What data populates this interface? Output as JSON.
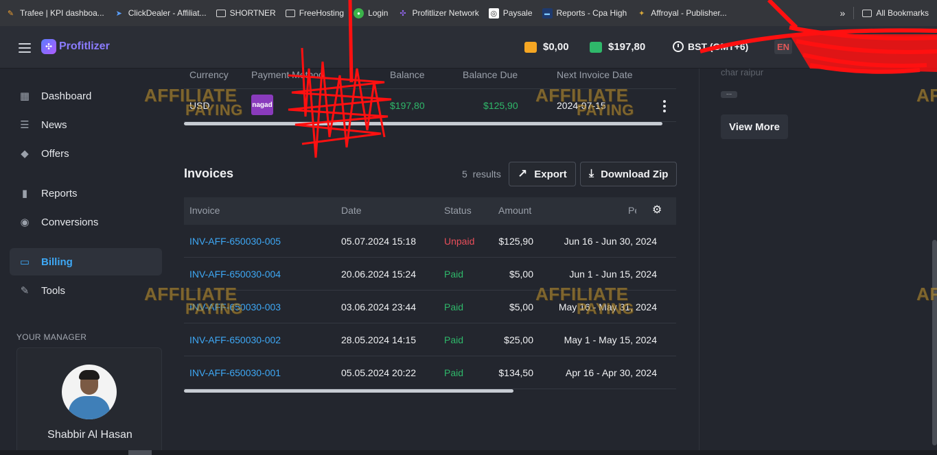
{
  "bookmarks": [
    {
      "label": "Trafee | KPI dashboa...",
      "icon": "trafee-icon"
    },
    {
      "label": "ClickDealer - Affiliat...",
      "icon": "clickdealer-icon"
    },
    {
      "label": "SHORTNER",
      "icon": "folder-icon"
    },
    {
      "label": "FreeHosting",
      "icon": "folder-icon"
    },
    {
      "label": "Login",
      "icon": "login-site-icon"
    },
    {
      "label": "Profitlizer Network",
      "icon": "profitlizer-icon"
    },
    {
      "label": "Paysale",
      "icon": "paysale-icon"
    },
    {
      "label": "Reports - Cpa High",
      "icon": "cpahigh-icon"
    },
    {
      "label": "Affroyal - Publisher...",
      "icon": "affroyal-icon"
    }
  ],
  "bookmarks_all": "All Bookmarks",
  "header": {
    "logo_text": "Profitlizer",
    "wallet1": "$0,00",
    "wallet2": "$197,80",
    "timezone": "BST (GMT+6)",
    "language": "EN"
  },
  "sidebar": {
    "items": [
      {
        "label": "Dashboard",
        "icon": "dashboard-icon"
      },
      {
        "label": "News",
        "icon": "news-icon"
      },
      {
        "label": "Offers",
        "icon": "tag-icon"
      },
      {
        "label": "Reports",
        "icon": "bar-chart-icon"
      },
      {
        "label": "Conversions",
        "icon": "conversions-icon"
      },
      {
        "label": "Billing",
        "icon": "credit-card-icon",
        "active": true
      },
      {
        "label": "Tools",
        "icon": "wrench-icon"
      }
    ],
    "manager_title": "YOUR MANAGER",
    "manager_name": "Shabbir Al Hasan"
  },
  "balance_table": {
    "headers": [
      "Currency",
      "Payment Method",
      "Balance",
      "Balance Due",
      "Next Invoice Date"
    ],
    "row": {
      "currency": "USD",
      "payment_logo_text": "nagad",
      "balance": "$197,80",
      "balance_due": "$125,90",
      "next_invoice_date": "2024-07-15"
    }
  },
  "invoices": {
    "title": "Invoices",
    "results_count": "5",
    "results_label": "results",
    "export_label": "Export",
    "download_label": "Download Zip",
    "headers": [
      "Invoice",
      "Date",
      "Status",
      "Amount",
      "Pe"
    ],
    "rows": [
      {
        "invoice": "INV-AFF-650030-005",
        "date": "05.07.2024 15:18",
        "status": "Unpaid",
        "amount": "$125,90",
        "period": "Jun 16 - Jun 30, 2024"
      },
      {
        "invoice": "INV-AFF-650030-004",
        "date": "20.06.2024 15:24",
        "status": "Paid",
        "amount": "$5,00",
        "period": "Jun 1 - Jun 15, 2024"
      },
      {
        "invoice": "INV-AFF-650030-003",
        "date": "03.06.2024 23:44",
        "status": "Paid",
        "amount": "$5,00",
        "period": "May 16 - May 31, 2024"
      },
      {
        "invoice": "INV-AFF-650030-002",
        "date": "28.05.2024 14:15",
        "status": "Paid",
        "amount": "$25,00",
        "period": "May 1 - May 15, 2024"
      },
      {
        "invoice": "INV-AFF-650030-001",
        "date": "05.05.2024 20:22",
        "status": "Paid",
        "amount": "$134,50",
        "period": "Apr 16 - Apr 30, 2024"
      }
    ]
  },
  "right_panel": {
    "address_fragment": "char raipur",
    "more_dots": "...",
    "view_more_label": "View More"
  },
  "watermark": {
    "line1": "AFFILIATE",
    "line2": "PAYING"
  },
  "colors": {
    "accent": "#3ea8f5",
    "paid": "#2fb86a",
    "unpaid": "#e84e5a",
    "background": "#23262e"
  }
}
